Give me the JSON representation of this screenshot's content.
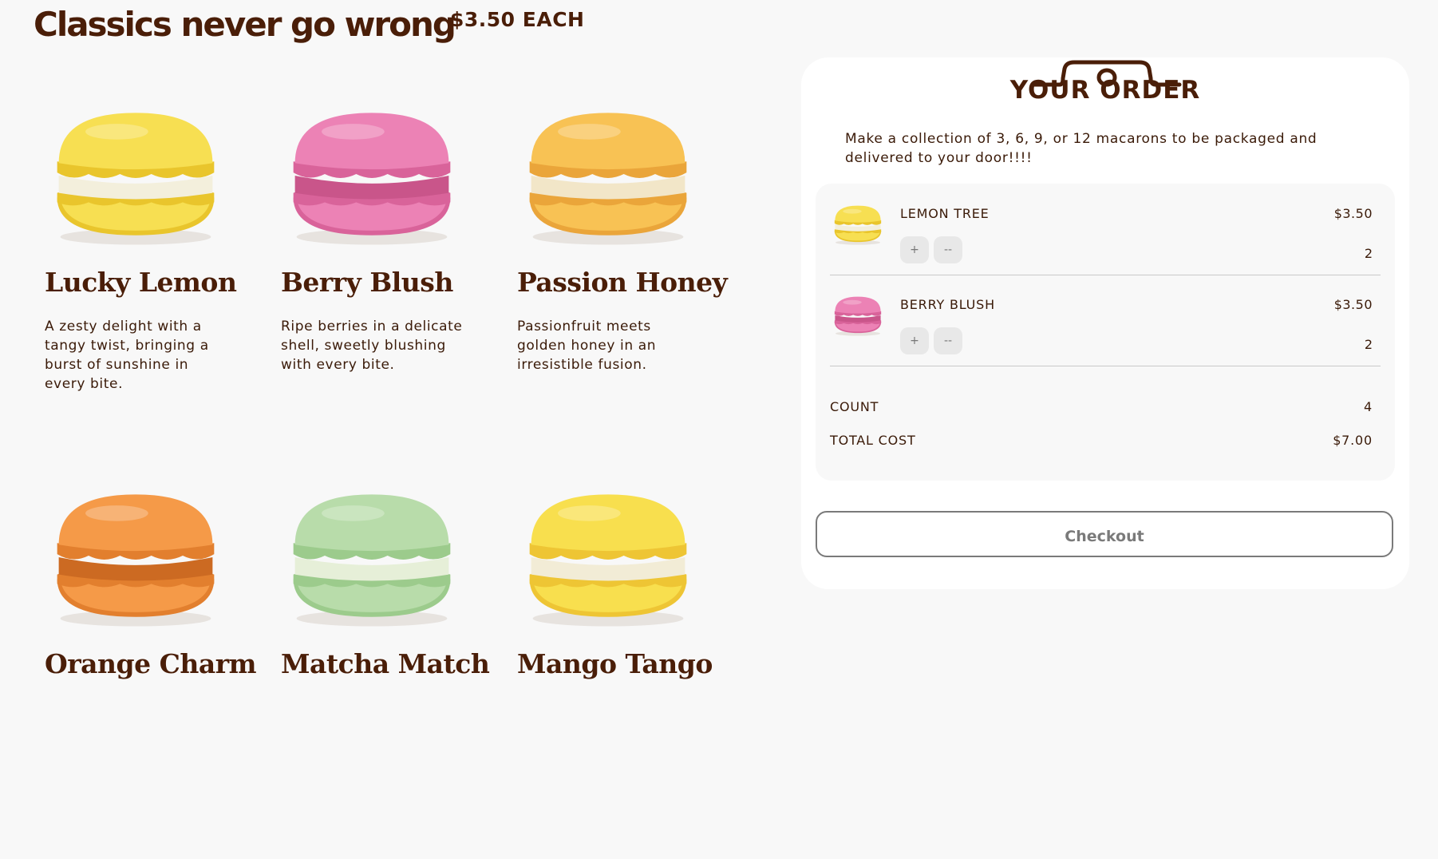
{
  "header": {
    "title": "Classics never go wrong",
    "price": "$3.50 EACH"
  },
  "products": [
    {
      "name": "Lucky Lemon",
      "desc": "A zesty delight with a tangy twist, bringing a burst of sunshine in every bite.",
      "shell": "#f7df52",
      "shell_dark": "#e9c52c",
      "filling": "#f3efdc"
    },
    {
      "name": "Berry Blush",
      "desc": "Ripe berries in a delicate shell, sweetly blushing with every bite.",
      "shell": "#ec82b5",
      "shell_dark": "#d9639a",
      "filling": "#c9558a"
    },
    {
      "name": "Passion Honey",
      "desc": "Passionfruit meets golden honey in an irresistible fusion.",
      "shell": "#f8c254",
      "shell_dark": "#eaa53a",
      "filling": "#f2e6c8"
    },
    {
      "name": "Orange Charm",
      "desc": "",
      "shell": "#f59a48",
      "shell_dark": "#e27f2e",
      "filling": "#cc6a22"
    },
    {
      "name": "Matcha Match",
      "desc": "",
      "shell": "#b8dcaa",
      "shell_dark": "#9ccb8c",
      "filling": "#e6efd8"
    },
    {
      "name": "Mango Tango",
      "desc": "",
      "shell": "#f8df4e",
      "shell_dark": "#eec534",
      "filling": "#f2ecd6"
    }
  ],
  "order": {
    "title": "YOUR ORDER",
    "description": "Make a collection of 3, 6, 9, or 12 macarons to be packaged and delivered to your door!!!!",
    "items": [
      {
        "name": "LEMON TREE",
        "price": "$3.50",
        "qty": "2",
        "plus": "+",
        "minus": "--",
        "shell": "#f7df52",
        "shell_dark": "#e9c52c",
        "filling": "#f3efdc"
      },
      {
        "name": "BERRY BLUSH",
        "price": "$3.50",
        "qty": "2",
        "plus": "+",
        "minus": "--",
        "shell": "#ec82b5",
        "shell_dark": "#d9639a",
        "filling": "#c9558a"
      }
    ],
    "count_label": "COUNT",
    "count_value": "4",
    "total_label": "TOTAL COST",
    "total_value": "$7.00",
    "checkout_label": "Checkout"
  },
  "colors": {
    "brand_brown": "#4a1e08",
    "background": "#f8f8f8"
  }
}
